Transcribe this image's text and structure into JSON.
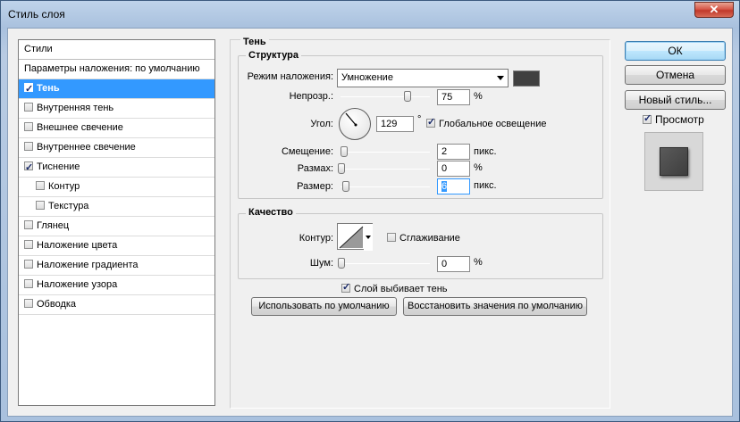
{
  "window": {
    "title": "Стиль слоя",
    "close_icon": "close-icon"
  },
  "styles": {
    "header": "Стили",
    "blending_options": "Параметры наложения: по умолчанию",
    "items": [
      {
        "label": "Тень",
        "checked": true,
        "selected": true,
        "sub": false
      },
      {
        "label": "Внутренняя тень",
        "checked": false,
        "selected": false,
        "sub": false
      },
      {
        "label": "Внешнее свечение",
        "checked": false,
        "selected": false,
        "sub": false
      },
      {
        "label": "Внутреннее свечение",
        "checked": false,
        "selected": false,
        "sub": false
      },
      {
        "label": "Тиснение",
        "checked": true,
        "selected": false,
        "sub": false
      },
      {
        "label": "Контур",
        "checked": false,
        "selected": false,
        "sub": true
      },
      {
        "label": "Текстура",
        "checked": false,
        "selected": false,
        "sub": true
      },
      {
        "label": "Глянец",
        "checked": false,
        "selected": false,
        "sub": false
      },
      {
        "label": "Наложение цвета",
        "checked": false,
        "selected": false,
        "sub": false
      },
      {
        "label": "Наложение градиента",
        "checked": false,
        "selected": false,
        "sub": false
      },
      {
        "label": "Наложение узора",
        "checked": false,
        "selected": false,
        "sub": false
      },
      {
        "label": "Обводка",
        "checked": false,
        "selected": false,
        "sub": false
      }
    ]
  },
  "shadow": {
    "title": "Тень",
    "structure": {
      "title": "Структура",
      "blend_mode_label": "Режим наложения:",
      "blend_mode_value": "Умножение",
      "shadow_color": "#404040",
      "opacity_label": "Непрозр.:",
      "opacity_value": "75",
      "opacity_unit": "%",
      "opacity_level": 0.75,
      "angle_label": "Угол:",
      "angle_value": "129",
      "angle_unit": "°",
      "global_light_label": "Глобальное освещение",
      "global_light_checked": true,
      "distance_label": "Смещение:",
      "distance_value": "2",
      "distance_unit": "пикс.",
      "spread_label": "Размах:",
      "spread_value": "0",
      "spread_unit": "%",
      "size_label": "Размер:",
      "size_value": "6",
      "size_unit": "пикс."
    },
    "quality": {
      "title": "Качество",
      "contour_label": "Контур:",
      "antialias_label": "Сглаживание",
      "antialias_checked": false,
      "noise_label": "Шум:",
      "noise_value": "0",
      "noise_unit": "%"
    },
    "layer_knocks_out_label": "Слой выбивает тень",
    "layer_knocks_out_checked": true,
    "use_default_button": "Использовать по умолчанию",
    "reset_default_button": "Восстановить значения по умолчанию"
  },
  "buttons": {
    "ok": "ОК",
    "cancel": "Отмена",
    "new_style": "Новый стиль...",
    "preview_label": "Просмотр",
    "preview_checked": true
  }
}
